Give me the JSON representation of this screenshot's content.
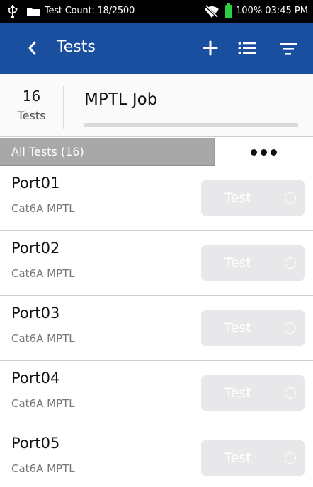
{
  "status_bar": {
    "test_count": "Test Count: 18/2500",
    "battery": "100% 03:45 PM",
    "icons": [
      "usb-icon",
      "folder-icon",
      "wifi-off-icon",
      "battery-icon"
    ]
  },
  "header": {
    "title": "Tests",
    "background": "#1a4fa0",
    "icons": [
      "back-chevron-icon",
      "add-icon",
      "list-icon",
      "filter-icon"
    ]
  },
  "summary": {
    "count": "16",
    "count_label": "Tests",
    "job_name": "MPTL Job"
  },
  "filter_bar": {
    "label": "All Tests (16)",
    "more_icon": "more-dots-icon"
  },
  "tests": [
    {
      "name": "Port01",
      "type": "Cat6A MPTL",
      "button": "Test"
    },
    {
      "name": "Port02",
      "type": "Cat6A MPTL",
      "button": "Test"
    },
    {
      "name": "Port03",
      "type": "Cat6A MPTL",
      "button": "Test"
    },
    {
      "name": "Port04",
      "type": "Cat6A MPTL",
      "button": "Test"
    },
    {
      "name": "Port05",
      "type": "Cat6A MPTL",
      "button": "Test"
    }
  ]
}
